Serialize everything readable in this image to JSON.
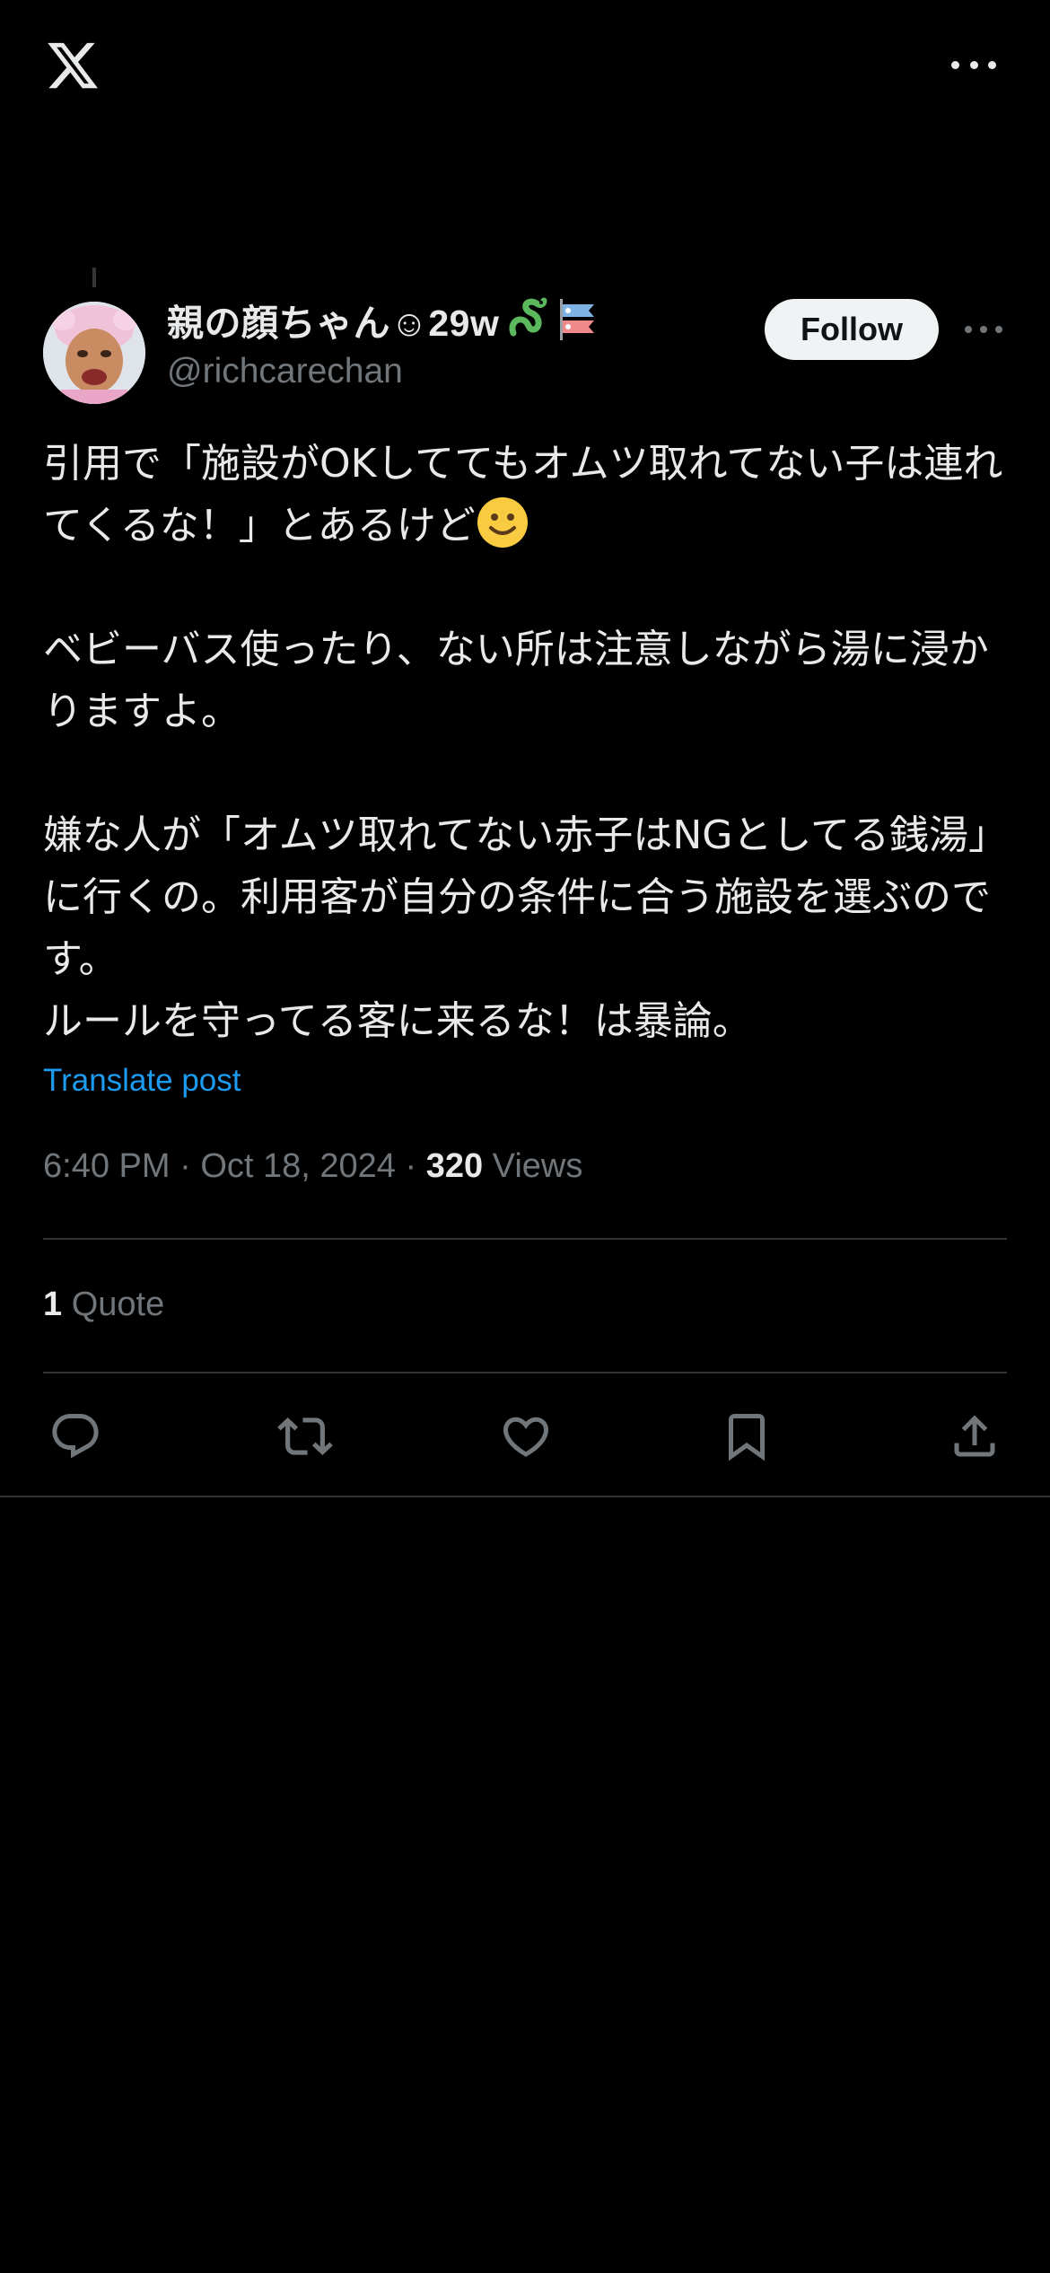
{
  "app": {
    "logo": "x-logo-icon",
    "more_icon": "more-horizontal-icon"
  },
  "post": {
    "author": {
      "display_name": "親の顔ちゃん☺︎29w",
      "name_emojis": [
        "dragon-icon",
        "carp-streamer-icon"
      ],
      "handle": "@richcarechan",
      "avatar": "avatar-image"
    },
    "follow_label": "Follow",
    "body": {
      "paragraph1": "引用で「施設がOKしててもオムツ取れてない子は連れてくるな！」とあるけど",
      "paragraph1_emoji": "slightly-smiling-face-icon",
      "paragraph2": "ベビーバス使ったり、ない所は注意しながら湯に浸かりますよ。",
      "paragraph3": "嫌な人が「オムツ取れてない赤子はNGとしてる銭湯」に行くの。利用客が自分の条件に合う施設を選ぶのです。",
      "paragraph4": "ルールを守ってる客に来るな！は暴論。"
    },
    "translate_label": "Translate post",
    "time": "6:40 PM",
    "date": "Oct 18, 2024",
    "separator": "·",
    "views_count": "320",
    "views_label": "Views",
    "quote_count": "1",
    "quote_label": "Quote",
    "actions": [
      "reply-icon",
      "repost-icon",
      "like-icon",
      "bookmark-icon",
      "share-icon"
    ]
  },
  "colors": {
    "background": "#000000",
    "text_primary": "#e7e9ea",
    "text_secondary": "#71767b",
    "accent": "#1d9bf0",
    "divider": "#2f3336"
  }
}
